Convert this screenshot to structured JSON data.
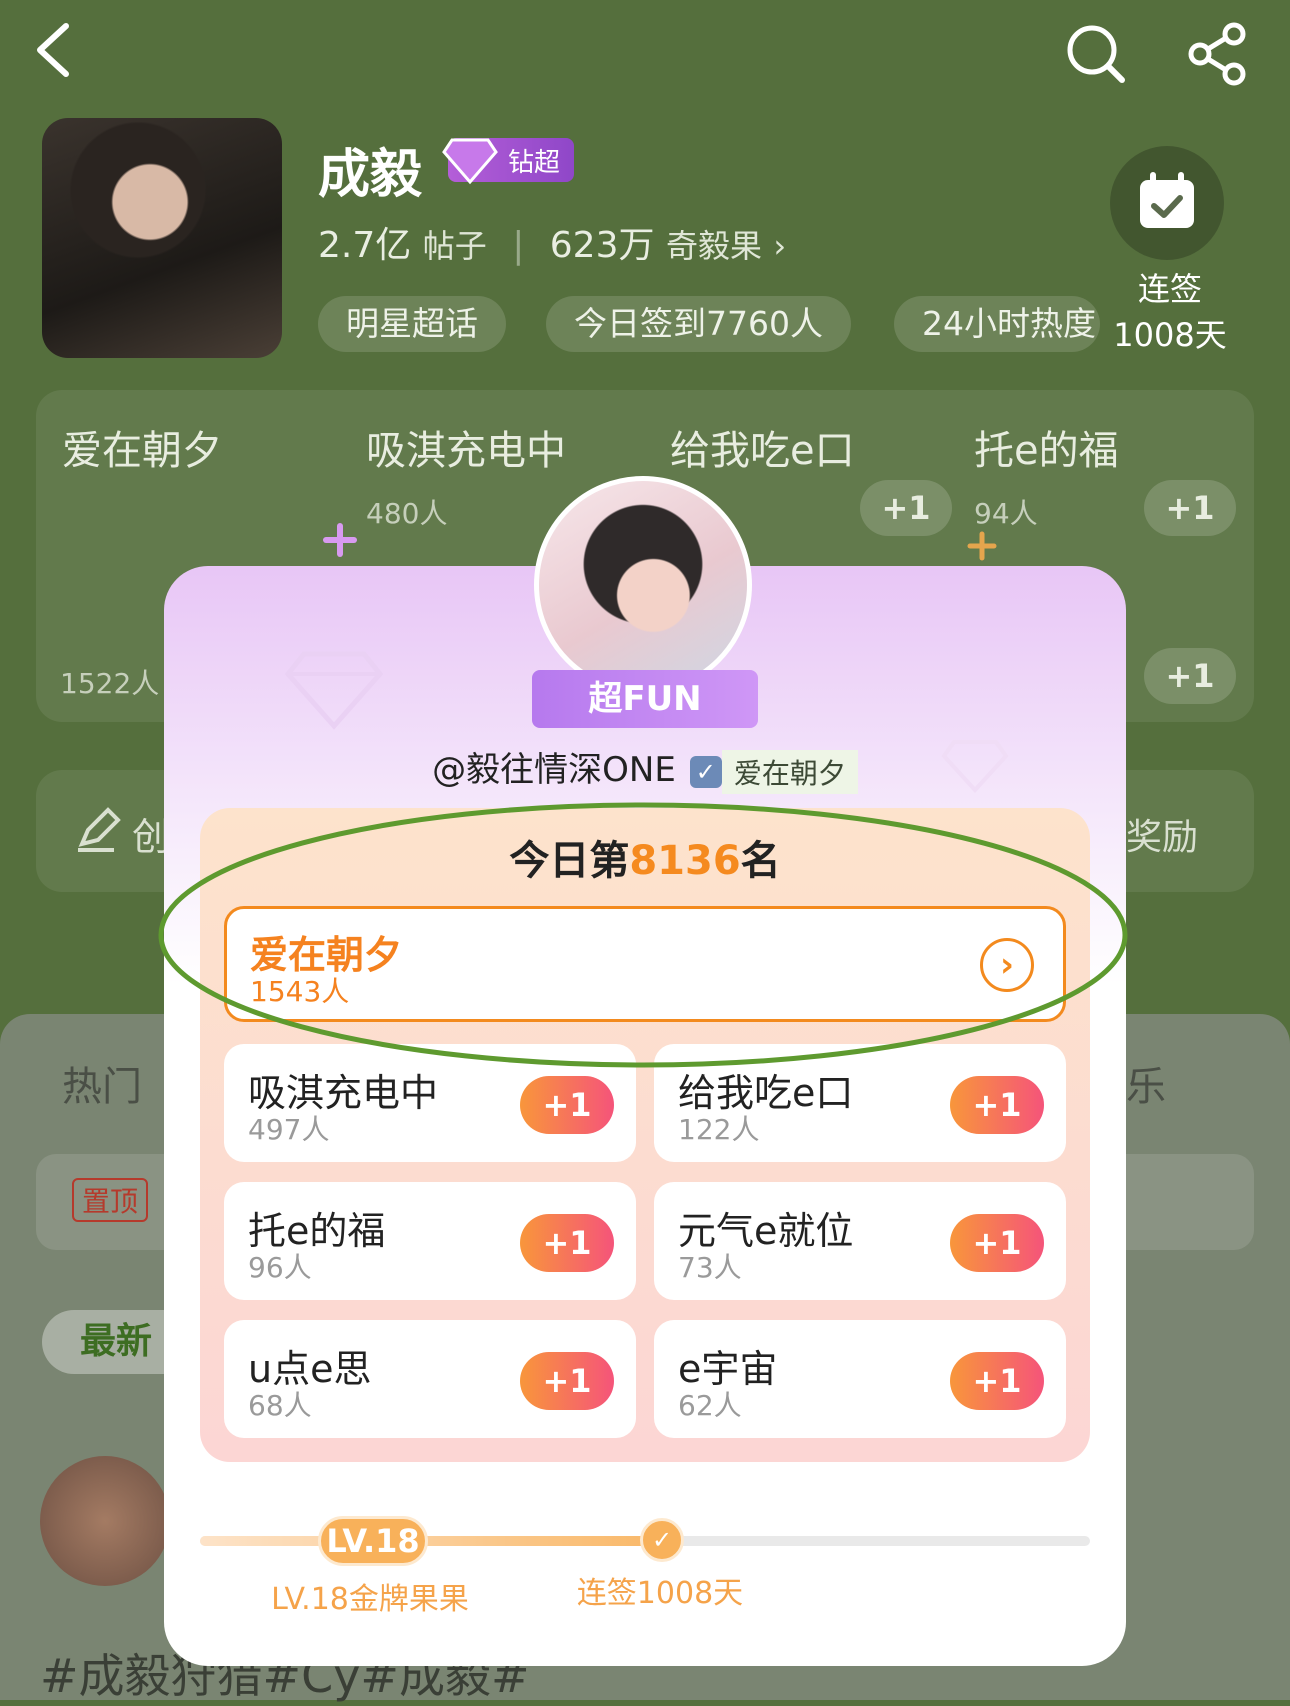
{
  "header": {
    "title": "成毅",
    "badge": "钻超"
  },
  "stats": {
    "posts_value": "2.7亿",
    "posts_label": "帖子",
    "fans_value": "623万",
    "fans_label": "奇毅果"
  },
  "pills": [
    "明星超话",
    "今日签到7760人",
    "24小时热度"
  ],
  "checkin": {
    "label": "连签",
    "days": "1008天"
  },
  "groups_bg": [
    {
      "name": "爱在朝夕",
      "count": "1522人"
    },
    {
      "name": "吸淇充电中",
      "count": "480人"
    },
    {
      "name": "给我吃e口",
      "count": ""
    },
    {
      "name": "托e的福",
      "count": "94人"
    }
  ],
  "plus_label": "+1",
  "bg_misc": {
    "creation": "创",
    "reward": "奖励",
    "hot_tab": "热门",
    "music_tab": "乐",
    "pinned": "置顶",
    "latest": "最新",
    "hashtag": "#成毅狩猎#Cy#成毅#"
  },
  "modal": {
    "ribbon": "超FUN",
    "username": "@毅往情深ONE",
    "verified_icon": "✓",
    "group_tag": "爱在朝夕",
    "rank_prefix": "今日第",
    "rank_number": "8136",
    "rank_suffix": "名",
    "current_group": {
      "name": "爱在朝夕",
      "count": "1543人"
    },
    "groups": [
      {
        "name": "吸淇充电中",
        "count": "497人"
      },
      {
        "name": "给我吃e口",
        "count": "122人"
      },
      {
        "name": "托e的福",
        "count": "96人"
      },
      {
        "name": "元气e就位",
        "count": "73人"
      },
      {
        "name": "u点e思",
        "count": "68人"
      },
      {
        "name": "e宇宙",
        "count": "62人"
      }
    ],
    "level_badge": "LV.18",
    "level_text": "LV.18金牌果果",
    "streak_text": "连签1008天"
  },
  "colors": {
    "accent": "#f5821f",
    "bg": "#556f3d",
    "highlight_ellipse": "#5e9a2f"
  }
}
